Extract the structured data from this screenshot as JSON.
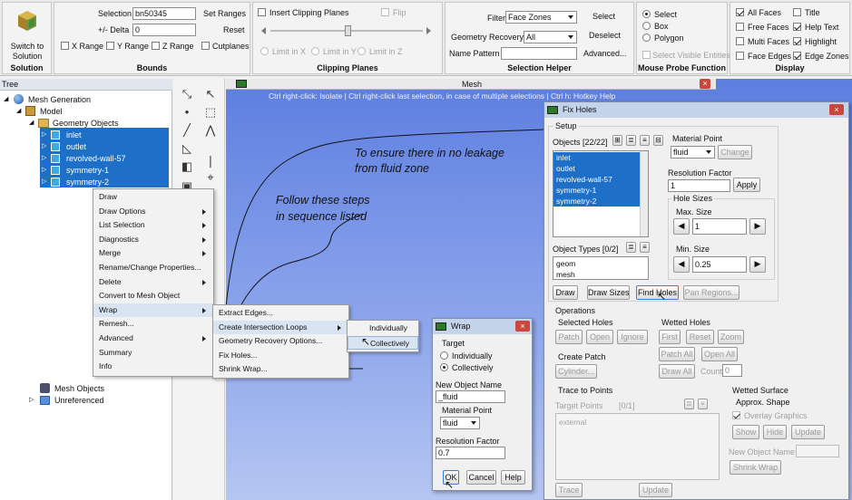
{
  "ribbon": {
    "solution": {
      "button_label_1": "Switch to",
      "button_label_2": "Solution",
      "title": "Solution"
    },
    "bounds": {
      "title": "Bounds",
      "selection_label": "Selection",
      "selection_value": "bn50345",
      "set_ranges": "Set Ranges",
      "delta_label": "+/- Delta",
      "delta_value": "0",
      "reset": "Reset",
      "x_range": "X Range",
      "y_range": "Y Range",
      "z_range": "Z Range",
      "cutplanes": "Cutplanes"
    },
    "clipping": {
      "title": "Clipping Planes",
      "insert": "Insert Clipping Planes",
      "flip": "Flip",
      "limit_x": "Limit in X",
      "limit_y": "Limit in Y",
      "limit_z": "Limit in Z"
    },
    "selection_helper": {
      "title": "Selection Helper",
      "filter_label": "Filter",
      "filter_value": "Face Zones",
      "select": "Select",
      "geometry_recovery_label": "Geometry Recovery",
      "geometry_recovery_value": "All",
      "deselect": "Deselect",
      "name_pattern_label": "Name Pattern",
      "advanced": "Advanced..."
    },
    "mouse_probe": {
      "title": "Mouse Probe Function",
      "select": "Select",
      "box": "Box",
      "polygon": "Polygon",
      "select_visible": "Select Visible Entities"
    },
    "display": {
      "title": "Display",
      "all_faces": "All Faces",
      "title_opt": "Title",
      "free_faces": "Free Faces",
      "help_text": "Help Text",
      "multi_faces": "Multi Faces",
      "highlight": "Highlight",
      "face_edges": "Face Edges",
      "edge_zones": "Edge Zones"
    }
  },
  "tree": {
    "header": "Tree",
    "items": [
      {
        "label": "Mesh Generation"
      },
      {
        "label": "Model"
      },
      {
        "label": "Geometry Objects"
      },
      {
        "label": "inlet"
      },
      {
        "label": "outlet"
      },
      {
        "label": "revolved-wall-57"
      },
      {
        "label": "symmetry-1"
      },
      {
        "label": "symmetry-2"
      },
      {
        "label": "Mesh Objects"
      },
      {
        "label": "Unreferenced"
      }
    ]
  },
  "context_menu": {
    "items": [
      "Draw",
      "Draw Options",
      "List Selection",
      "Diagnostics",
      "Merge",
      "Rename/Change Properties...",
      "Delete",
      "Convert to Mesh Object",
      "Wrap",
      "Remesh...",
      "Advanced",
      "Summary",
      "Info"
    ]
  },
  "wrap_submenu": {
    "items": [
      "Extract Edges...",
      "Create Intersection Loops",
      "Geometry Recovery Options...",
      "Fix Holes...",
      "Shrink Wrap..."
    ]
  },
  "loops_submenu": {
    "items": [
      "Individually",
      "Collectively"
    ]
  },
  "mesh_tab": {
    "title": "Mesh",
    "hint": "Ctrl right-click: Isolate | Ctrl right-click last selection, in case of multiple selections | Ctrl h: Hotkey Help"
  },
  "annotations": {
    "note1_line1": "To ensure there in no leakage",
    "note1_line2": "from fluid zone",
    "note2_line1": "Follow these steps",
    "note2_line2": "in sequence listed"
  },
  "wrap_dialog": {
    "title": "Wrap",
    "target_label": "Target",
    "individually": "Individually",
    "collectively": "Collectively",
    "new_object_label": "New Object Name",
    "new_object_value": "_fluid",
    "material_label": "Material Point",
    "material_value": "fluid",
    "resolution_label": "Resolution Factor",
    "resolution_value": "0.7",
    "ok": "OK",
    "cancel": "Cancel",
    "help": "Help"
  },
  "fix_holes": {
    "title": "Fix Holes",
    "setup": "Setup",
    "objects_label": "Objects [22/22]",
    "objects": [
      "inlet",
      "outlet",
      "revolved-wall-57",
      "symmetry-1",
      "symmetry-2"
    ],
    "object_types_label": "Object Types [0/2]",
    "object_types": [
      "geom",
      "mesh"
    ],
    "material_point_label": "Material Point",
    "material_point_value": "fluid",
    "change": "Change",
    "resolution_label": "Resolution Factor",
    "resolution_value": "1",
    "apply": "Apply",
    "hole_sizes": "Hole Sizes",
    "max_size_label": "Max. Size",
    "max_size_value": "1",
    "min_size_label": "Min. Size",
    "min_size_value": "0.25",
    "draw": "Draw",
    "draw_sizes": "Draw Sizes",
    "find_holes": "Find Holes",
    "pan_regions": "Pan Regions...",
    "operations": "Operations",
    "selected_holes": "Selected Holes",
    "patch": "Patch",
    "open": "Open",
    "ignore": "Ignore",
    "create_patch": "Create Patch",
    "cylinder": "Cylinder...",
    "wetted_holes": "Wetted Holes",
    "first": "First",
    "reset": "Reset",
    "zoom": "Zoom",
    "patch_all": "Patch All",
    "open_all": "Open All",
    "draw_all": "Draw All",
    "count_label": "Count",
    "count_value": "0",
    "trace_to_points": "Trace to Points",
    "target_points_label": "Target Points",
    "target_points_count": "[0/1]",
    "target_point_item": "external",
    "trace": "Trace",
    "update": "Update",
    "wetted_surface": "Wetted Surface",
    "approx_shape": "Approx. Shape",
    "overlay_graphics": "Overlay Graphics",
    "show": "Show",
    "hide": "Hide",
    "update2": "Update",
    "new_object_name": "New Object Name",
    "shrink_wrap": "Shrink Wrap"
  },
  "colors": {
    "selection_blue": "#1e6fc8",
    "viewport_blue": "#6f8de3",
    "dialog_title": "#c3d4ea"
  }
}
